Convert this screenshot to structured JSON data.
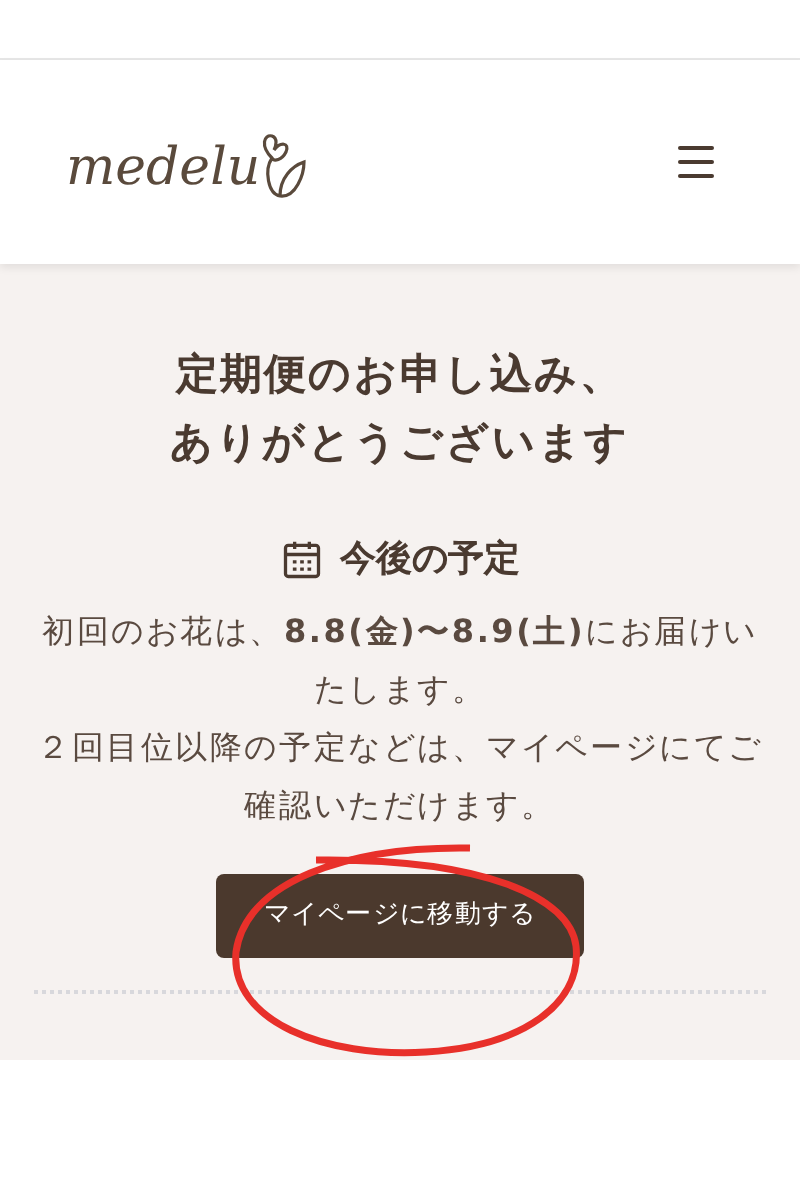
{
  "header": {
    "logo": "medelu"
  },
  "title_lines": [
    "定期便のお申し込み、",
    "ありがとうございます"
  ],
  "schedule": {
    "heading": "今後の予定",
    "paragraphs": [
      "初回のお花は、**8.8(金)〜8.9(土)**にお届けいたします。",
      "２回目位以降の予定などは、マイページにてご確認いただけます。"
    ]
  },
  "button": {
    "label": "マイページに移動する"
  }
}
